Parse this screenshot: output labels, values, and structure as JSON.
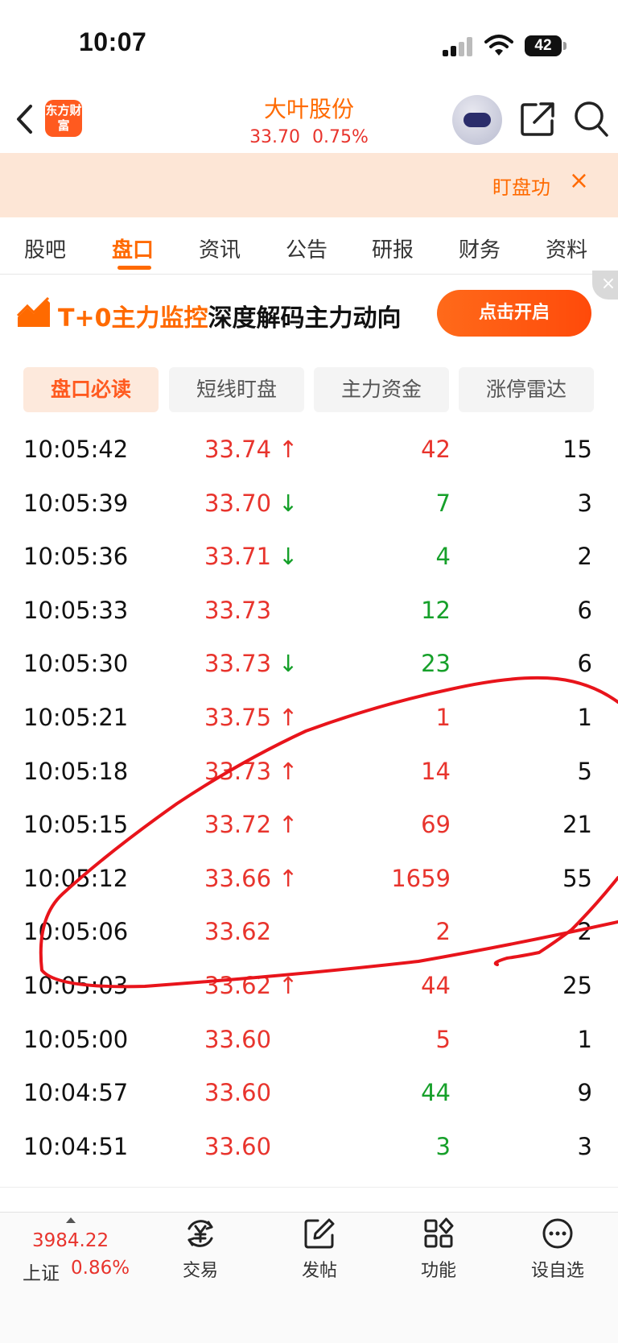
{
  "status_bar": {
    "time": "10:07",
    "battery": "42"
  },
  "header": {
    "logo_text": "东方财富",
    "stock_name": "大叶股份",
    "price": "33.70",
    "change_pct": "0.75%"
  },
  "banner": {
    "text": "盯盘功",
    "close": "×"
  },
  "tabs": [
    "股吧",
    "盘口",
    "资讯",
    "公告",
    "研报",
    "财务",
    "资料"
  ],
  "active_tab": "盘口",
  "promo": {
    "highlight": "T+0主力监控",
    "rest": "深度解码主力动向",
    "button": "点击开启",
    "close": "×"
  },
  "subtabs": [
    "盘口必读",
    "短线盯盘",
    "主力资金",
    "涨停雷达"
  ],
  "trades": [
    {
      "time": "10:05:42",
      "price": "33.74",
      "arrow": "↑",
      "volume": "42",
      "vol_dir": "up",
      "count": "15"
    },
    {
      "time": "10:05:39",
      "price": "33.70",
      "arrow": "↓",
      "volume": "7",
      "vol_dir": "down",
      "count": "3"
    },
    {
      "time": "10:05:36",
      "price": "33.71",
      "arrow": "↓",
      "volume": "4",
      "vol_dir": "down",
      "count": "2"
    },
    {
      "time": "10:05:33",
      "price": "33.73",
      "arrow": "",
      "volume": "12",
      "vol_dir": "down",
      "count": "6"
    },
    {
      "time": "10:05:30",
      "price": "33.73",
      "arrow": "↓",
      "volume": "23",
      "vol_dir": "down",
      "count": "6"
    },
    {
      "time": "10:05:21",
      "price": "33.75",
      "arrow": "↑",
      "volume": "1",
      "vol_dir": "up",
      "count": "1"
    },
    {
      "time": "10:05:18",
      "price": "33.73",
      "arrow": "↑",
      "volume": "14",
      "vol_dir": "up",
      "count": "5"
    },
    {
      "time": "10:05:15",
      "price": "33.72",
      "arrow": "↑",
      "volume": "69",
      "vol_dir": "up",
      "count": "21"
    },
    {
      "time": "10:05:12",
      "price": "33.66",
      "arrow": "↑",
      "volume": "1659",
      "vol_dir": "up",
      "count": "55"
    },
    {
      "time": "10:05:06",
      "price": "33.62",
      "arrow": "",
      "volume": "2",
      "vol_dir": "up",
      "count": "2"
    },
    {
      "time": "10:05:03",
      "price": "33.62",
      "arrow": "↑",
      "volume": "44",
      "vol_dir": "up",
      "count": "25"
    },
    {
      "time": "10:05:00",
      "price": "33.60",
      "arrow": "",
      "volume": "5",
      "vol_dir": "up",
      "count": "1"
    },
    {
      "time": "10:04:57",
      "price": "33.60",
      "arrow": "",
      "volume": "44",
      "vol_dir": "down",
      "count": "9"
    },
    {
      "time": "10:04:51",
      "price": "33.60",
      "arrow": "",
      "volume": "3",
      "vol_dir": "down",
      "count": "3"
    }
  ],
  "bottom_nav": {
    "index_value": "3984.22",
    "index_name": "上证",
    "index_pct": "0.86%",
    "items": [
      {
        "label": "交易",
        "icon": "trade-yen-icon"
      },
      {
        "label": "发帖",
        "icon": "edit-post-icon"
      },
      {
        "label": "功能",
        "icon": "grid-function-icon"
      },
      {
        "label": "设自选",
        "icon": "more-dots-icon"
      }
    ]
  },
  "colors": {
    "accent": "#ff6a00",
    "up": "#e8342d",
    "down": "#16a02a",
    "annotation": "#e8141b"
  }
}
